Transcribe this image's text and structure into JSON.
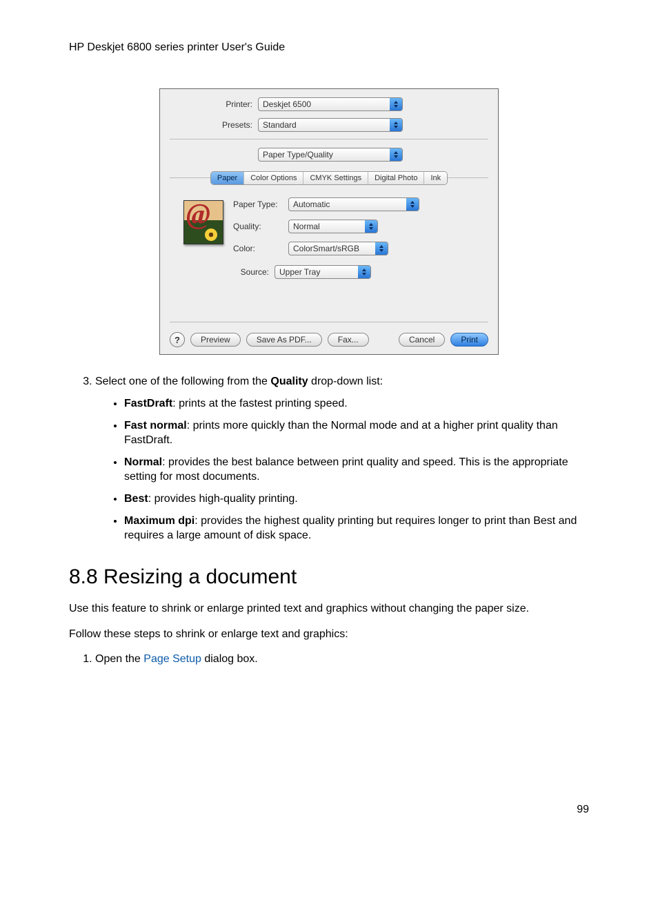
{
  "header": {
    "doc_title": "HP Deskjet 6800 series printer User's Guide"
  },
  "dialog": {
    "printer_label": "Printer:",
    "printer_value": "Deskjet 6500",
    "presets_label": "Presets:",
    "presets_value": "Standard",
    "pane_value": "Paper Type/Quality",
    "tabs": [
      "Paper",
      "Color Options",
      "CMYK Settings",
      "Digital Photo",
      "Ink"
    ],
    "paper_type_label": "Paper Type:",
    "paper_type_value": "Automatic",
    "quality_label": "Quality:",
    "quality_value": "Normal",
    "color_label": "Color:",
    "color_value": "ColorSmart/sRGB",
    "source_label": "Source:",
    "source_value": "Upper Tray",
    "help": "?",
    "preview": "Preview",
    "save_pdf": "Save As PDF...",
    "fax": "Fax...",
    "cancel": "Cancel",
    "print": "Print"
  },
  "body": {
    "step3_prefix_number": "3.",
    "step3_text_before": "Select one of the following from the ",
    "step3_bold": "Quality",
    "step3_text_after": " drop-down list:",
    "bullets": [
      {
        "b": "FastDraft",
        "rest": ": prints at the fastest printing speed."
      },
      {
        "b": "Fast normal",
        "rest": ": prints more quickly than the Normal mode and at a higher print quality than FastDraft."
      },
      {
        "b": "Normal",
        "rest": ": provides the best balance between print quality and speed. This is the appropriate setting for most documents."
      },
      {
        "b": "Best",
        "rest": ": provides high-quality printing."
      },
      {
        "b": "Maximum dpi",
        "rest": ": provides the highest quality printing but requires longer to print than Best and requires a large amount of disk space."
      }
    ],
    "section_title": "8.8  Resizing a document",
    "p1": "Use this feature to shrink or enlarge printed text and graphics without changing the paper size.",
    "p2": "Follow these steps to shrink or enlarge text and graphics:",
    "step1_before": "Open the ",
    "step1_link": "Page Setup",
    "step1_after": " dialog box.",
    "page_number": "99"
  }
}
